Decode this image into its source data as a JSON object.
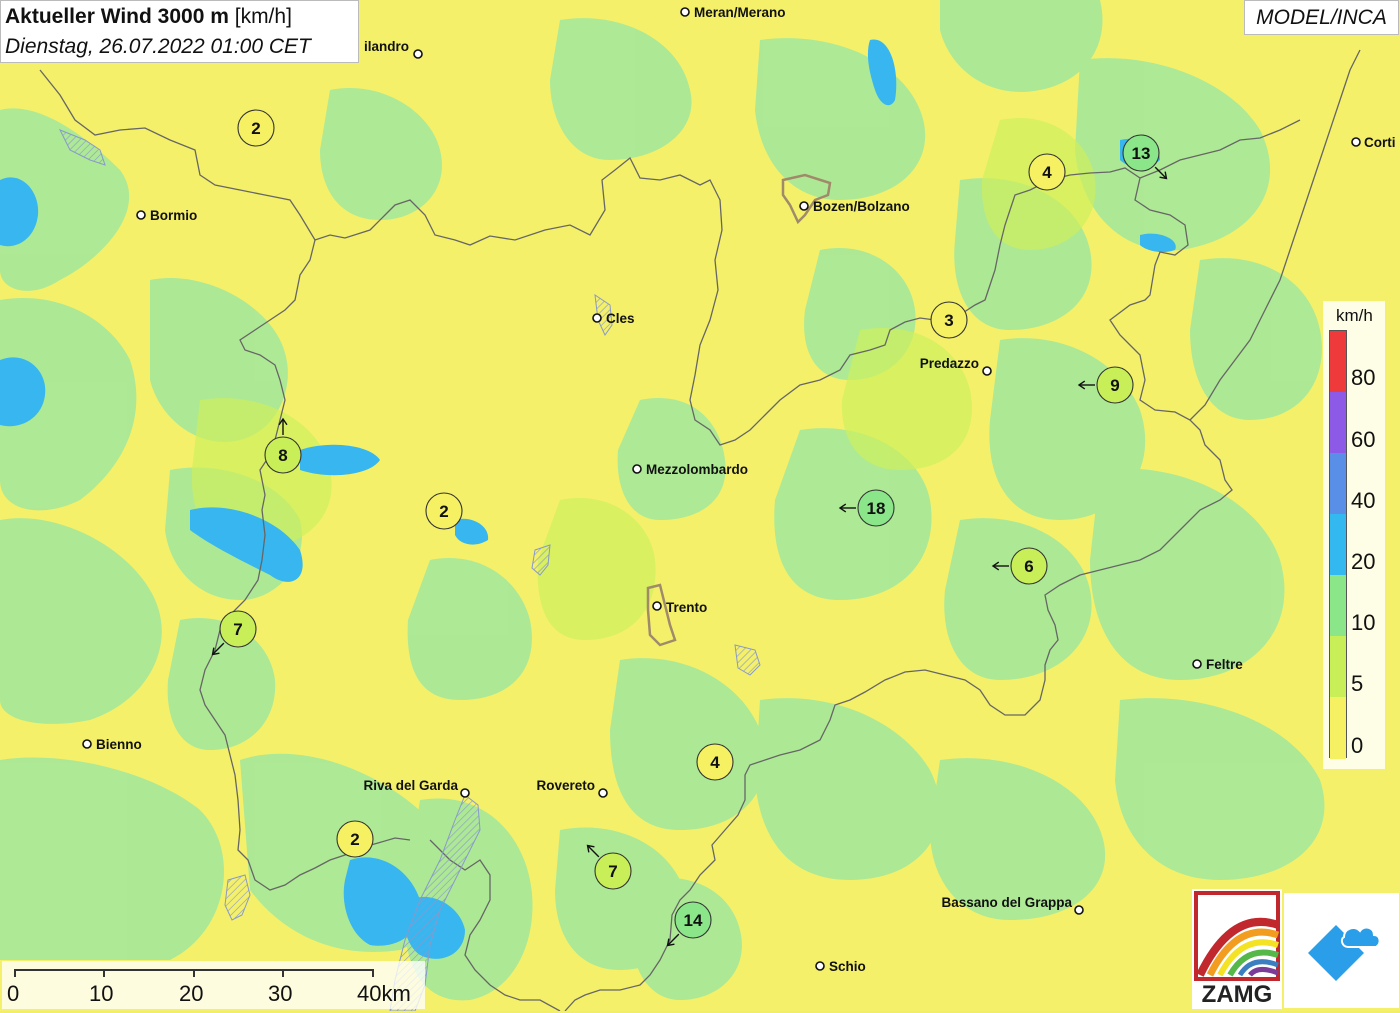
{
  "header": {
    "title_bold": "Aktueller Wind 3000 m",
    "title_unit": "[km/h]",
    "datetime": "Dienstag, 26.07.2022 01:00 CET",
    "model": "MODEL/INCA"
  },
  "colors": {
    "wind_0_5": "#f6f163",
    "wind_5_10": "#c8ee58",
    "wind_10_20": "#8ae689",
    "wind_20_40": "#33b8f0",
    "wind_40_60": "#5a8fe8",
    "wind_60_80": "#8c5ae6",
    "wind_80_plus": "#ee3a3a",
    "border": "#666666",
    "lake_hatch": "#8899cc"
  },
  "cities": [
    {
      "name": "Meran/Merano"
    },
    {
      "name": "ilandro"
    },
    {
      "name": "Bormio"
    },
    {
      "name": "Bozen/Bolzano"
    },
    {
      "name": "Corti"
    },
    {
      "name": "Cles"
    },
    {
      "name": "Predazzo"
    },
    {
      "name": "Mezzolombardo"
    },
    {
      "name": "Trento"
    },
    {
      "name": "Feltre"
    },
    {
      "name": "Bienno"
    },
    {
      "name": "Riva del Garda"
    },
    {
      "name": "Rovereto"
    },
    {
      "name": "Bassano del Grappa"
    },
    {
      "name": "Schio"
    }
  ],
  "wind_stations": [
    {
      "value": "2",
      "arrow": "none",
      "class": "0-5"
    },
    {
      "value": "4",
      "arrow": "none",
      "class": "0-5"
    },
    {
      "value": "13",
      "arrow": "south-east",
      "class": "10-20"
    },
    {
      "value": "3",
      "arrow": "none",
      "class": "0-5"
    },
    {
      "value": "9",
      "arrow": "west",
      "class": "5-10"
    },
    {
      "value": "8",
      "arrow": "north",
      "class": "5-10"
    },
    {
      "value": "2",
      "arrow": "none",
      "class": "0-5"
    },
    {
      "value": "18",
      "arrow": "west",
      "class": "10-20"
    },
    {
      "value": "6",
      "arrow": "west",
      "class": "5-10"
    },
    {
      "value": "7",
      "arrow": "south-west",
      "class": "5-10"
    },
    {
      "value": "4",
      "arrow": "none",
      "class": "0-5"
    },
    {
      "value": "2",
      "arrow": "none",
      "class": "0-5"
    },
    {
      "value": "7",
      "arrow": "north-west",
      "class": "5-10"
    },
    {
      "value": "14",
      "arrow": "south-west",
      "class": "10-20"
    }
  ],
  "legend": {
    "unit": "km/h",
    "labels": [
      "80",
      "60",
      "40",
      "20",
      "10",
      "5",
      "0"
    ]
  },
  "scale_bar": {
    "labels": [
      "0",
      "10",
      "20",
      "30",
      "40km"
    ]
  },
  "logos": {
    "zamg_text": "ZAMG"
  }
}
